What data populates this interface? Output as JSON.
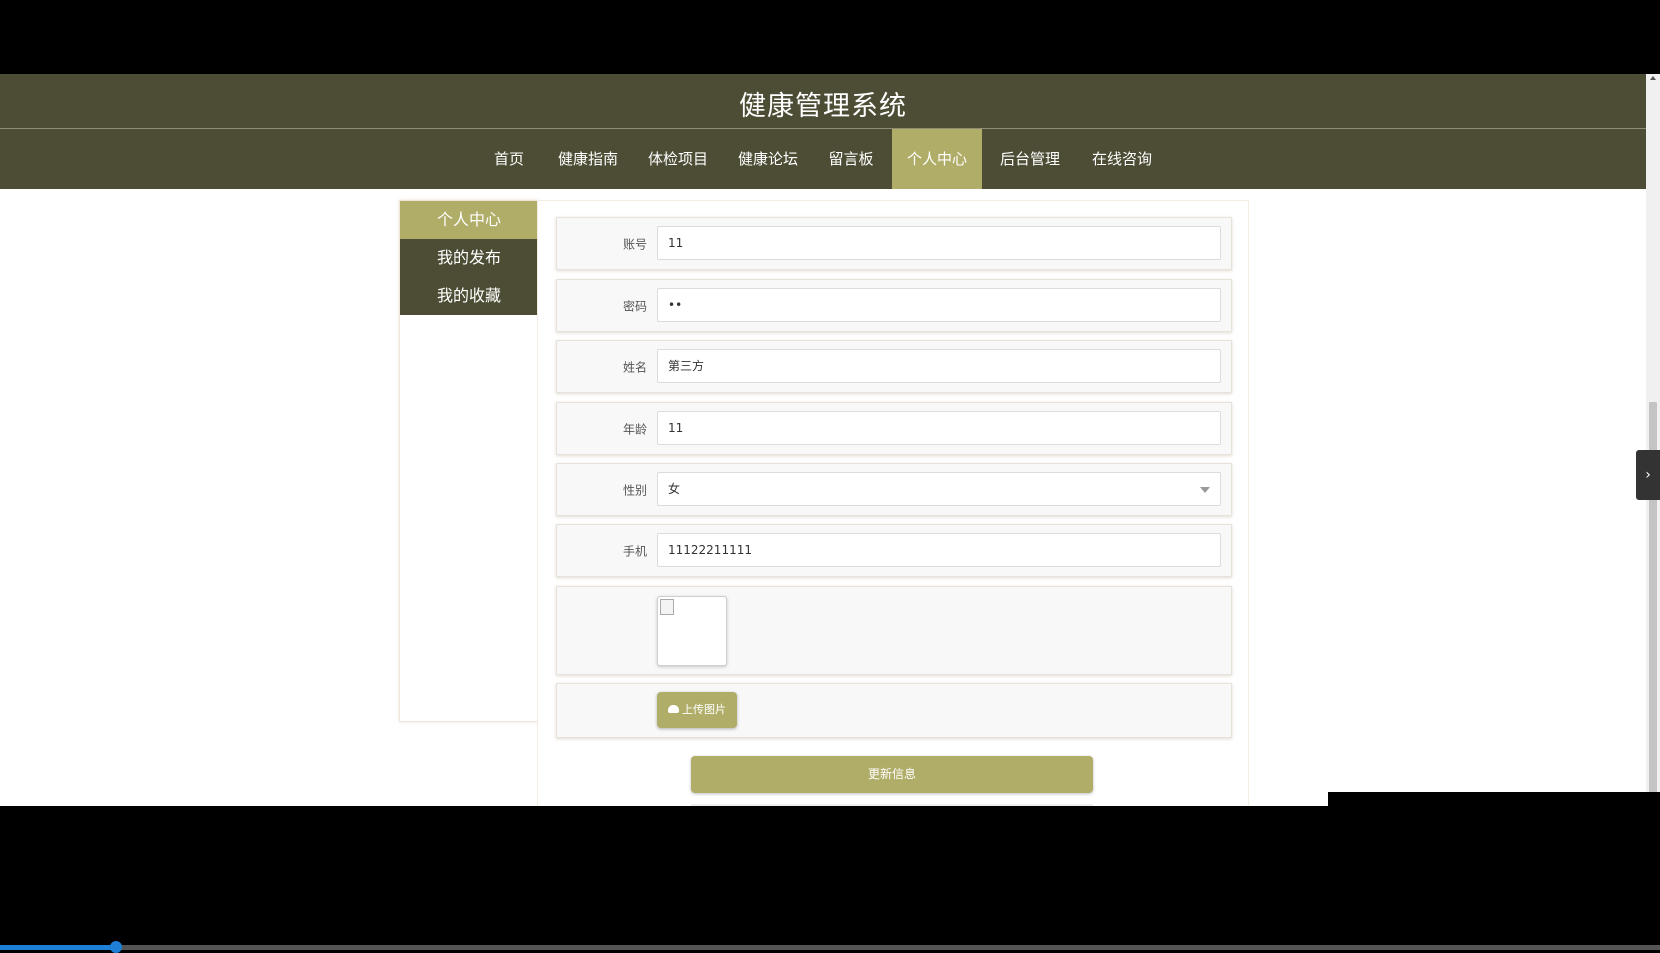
{
  "header": {
    "title": "健康管理系统"
  },
  "nav": {
    "items": [
      {
        "label": "首页"
      },
      {
        "label": "健康指南"
      },
      {
        "label": "体检项目"
      },
      {
        "label": "健康论坛"
      },
      {
        "label": "留言板"
      },
      {
        "label": "个人中心",
        "active": true
      },
      {
        "label": "后台管理"
      },
      {
        "label": "在线咨询"
      }
    ]
  },
  "sidebar": {
    "items": [
      {
        "label": "个人中心",
        "active": true
      },
      {
        "label": "我的发布"
      },
      {
        "label": "我的收藏"
      }
    ]
  },
  "form": {
    "account": {
      "label": "账号",
      "value": "11"
    },
    "password": {
      "label": "密码",
      "value": "••"
    },
    "name": {
      "label": "姓名",
      "value": "第三方"
    },
    "age": {
      "label": "年龄",
      "value": "11"
    },
    "gender": {
      "label": "性别",
      "value": "女"
    },
    "phone": {
      "label": "手机",
      "value": "11122211111"
    },
    "upload_label": "上传图片",
    "submit_label": "更新信息"
  },
  "colors": {
    "header_bg": "#4d4c34",
    "accent": "#b0ad69",
    "progress": "#1e7fd6"
  },
  "video": {
    "progress_fraction": 0.07
  }
}
